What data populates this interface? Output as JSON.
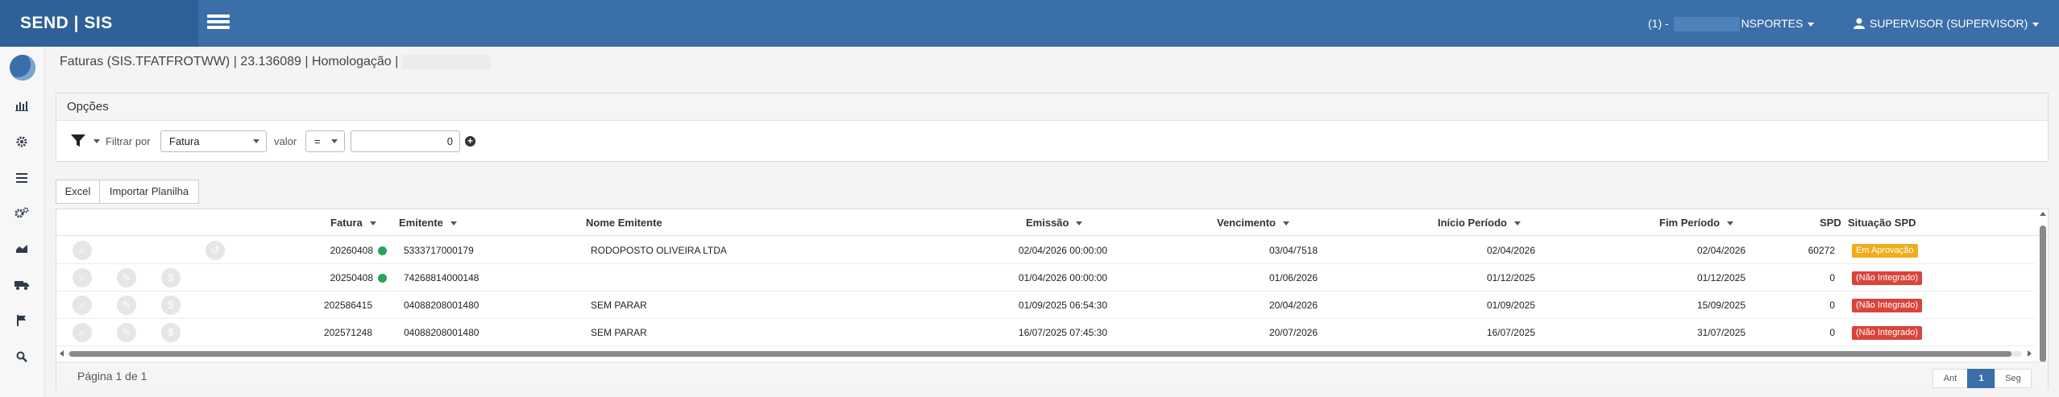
{
  "app": {
    "brand": "SEND | SIS"
  },
  "header": {
    "company_prefix": "(1) -",
    "company_suffix": "NSPORTES",
    "user_label": "SUPERVISOR (SUPERVISOR)"
  },
  "sidebar": {
    "items": [
      {
        "icon": "bar-chart-icon",
        "glyph": "📊"
      },
      {
        "icon": "gear-icon",
        "glyph": "⚙"
      },
      {
        "icon": "list-icon",
        "glyph": "☰"
      },
      {
        "icon": "gears-icon",
        "glyph": "⚙"
      },
      {
        "icon": "area-chart-icon",
        "glyph": "▲"
      },
      {
        "icon": "truck-icon",
        "glyph": "🚚"
      },
      {
        "icon": "flag-icon",
        "glyph": "⚑"
      },
      {
        "icon": "search-icon",
        "glyph": "⌕"
      }
    ]
  },
  "page": {
    "title": "Faturas (SIS.TFATFROTWW) | 23.136089 | Homologação |"
  },
  "options": {
    "title": "Opções",
    "filter_by_label": "Filtrar por",
    "filter_field_value": "Fatura",
    "value_label": "valor",
    "operator_value": "=",
    "input_value": "0"
  },
  "toolbar": {
    "excel_label": "Excel",
    "import_label": "Importar Planilha"
  },
  "grid": {
    "columns": {
      "fatura": "Fatura",
      "emitente": "Emitente",
      "nome_emitente": "Nome Emitente",
      "emissao": "Emissão",
      "vencimento": "Vencimento",
      "inicio_periodo": "Início Período",
      "fim_periodo": "Fim Período",
      "spd": "SPD",
      "situacao_spd": "Situação SPD"
    },
    "rows": [
      {
        "fatura": "20260408",
        "dot": true,
        "emitente": "5333717000179",
        "nome": "RODOPOSTO OLIVEIRA LTDA",
        "emissao": "02/04/2026 00:00:00",
        "vencimento": "03/04/7518",
        "inicio": "02/04/2026",
        "fim": "02/04/2026",
        "spd": "60272",
        "situacao": "Em Aprovação",
        "situacao_color": "#f0ad1c",
        "actions": "view-undo"
      },
      {
        "fatura": "20250408",
        "dot": true,
        "emitente": "74268814000148",
        "nome": "",
        "emissao": "01/04/2026 00:00:00",
        "vencimento": "01/06/2026",
        "inicio": "01/12/2025",
        "fim": "01/12/2025",
        "spd": "0",
        "situacao": "(Não Integrado)",
        "situacao_color": "#d9443b",
        "actions": "view-edit-money"
      },
      {
        "fatura": "202586415",
        "dot": false,
        "emitente": "04088208001480",
        "nome": "SEM PARAR",
        "emissao": "01/09/2025 06:54:30",
        "vencimento": "20/04/2026",
        "inicio": "01/09/2025",
        "fim": "15/09/2025",
        "spd": "0",
        "situacao": "(Não Integrado)",
        "situacao_color": "#d9443b",
        "actions": "view-edit-money"
      },
      {
        "fatura": "202571248",
        "dot": false,
        "emitente": "04088208001480",
        "nome": "SEM PARAR",
        "emissao": "16/07/2025 07:45:30",
        "vencimento": "20/07/2026",
        "inicio": "16/07/2025",
        "fim": "31/07/2025",
        "spd": "0",
        "situacao": "(Não Integrado)",
        "situacao_color": "#d9443b",
        "actions": "view-edit-money"
      }
    ],
    "footer": {
      "page_info": "Página 1 de 1",
      "prev_label": "Ant",
      "current_page": "1",
      "next_label": "Seg"
    }
  },
  "colors": {
    "primary": "#3a6fa9",
    "success": "#27a55a",
    "warning": "#f0ad1c",
    "danger": "#d9443b"
  }
}
